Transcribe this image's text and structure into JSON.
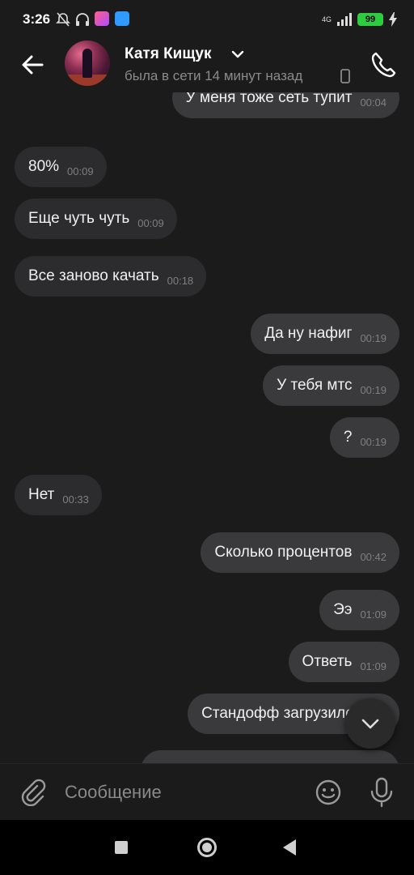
{
  "status_bar": {
    "time": "3:26",
    "network_label": "4G",
    "battery": "99",
    "icons": [
      "bell-off-icon",
      "headphones-icon",
      "app-icon-heart",
      "app-icon-blue",
      "signal-icon",
      "charging-icon"
    ]
  },
  "header": {
    "contact_name": "Катя Кищук",
    "contact_status": "была в сети 14 минут назад"
  },
  "messages": [
    {
      "direction": "out",
      "text": "У меня тоже сеть тупит",
      "time": "00:04"
    },
    {
      "direction": "in",
      "text": "80%",
      "time": "00:09"
    },
    {
      "direction": "in",
      "text": "Еще чуть чуть",
      "time": "00:09"
    },
    {
      "direction": "in",
      "text": "Все заново качать",
      "time": "00:18"
    },
    {
      "direction": "out",
      "text": "Да ну нафиг",
      "time": "00:19"
    },
    {
      "direction": "out",
      "text": "У тебя мтс",
      "time": "00:19"
    },
    {
      "direction": "out",
      "text": "?",
      "time": "00:19"
    },
    {
      "direction": "in",
      "text": "Нет",
      "time": "00:33"
    },
    {
      "direction": "out",
      "text": "Сколько процентов",
      "time": "00:42"
    },
    {
      "direction": "out",
      "text": "Ээ",
      "time": "01:09"
    },
    {
      "direction": "out",
      "text": "Ответь",
      "time": "01:09"
    },
    {
      "direction": "out",
      "text": "Стандофф загрузился??",
      "time": ""
    },
    {
      "direction": "out",
      "text": "",
      "time": ""
    }
  ],
  "composer": {
    "placeholder": "Сообщение"
  },
  "colors": {
    "background": "#1b1b1b",
    "incoming_bubble": "#2c2c2e",
    "outgoing_bubble": "#3a3a3c",
    "battery": "#2ecc40"
  }
}
